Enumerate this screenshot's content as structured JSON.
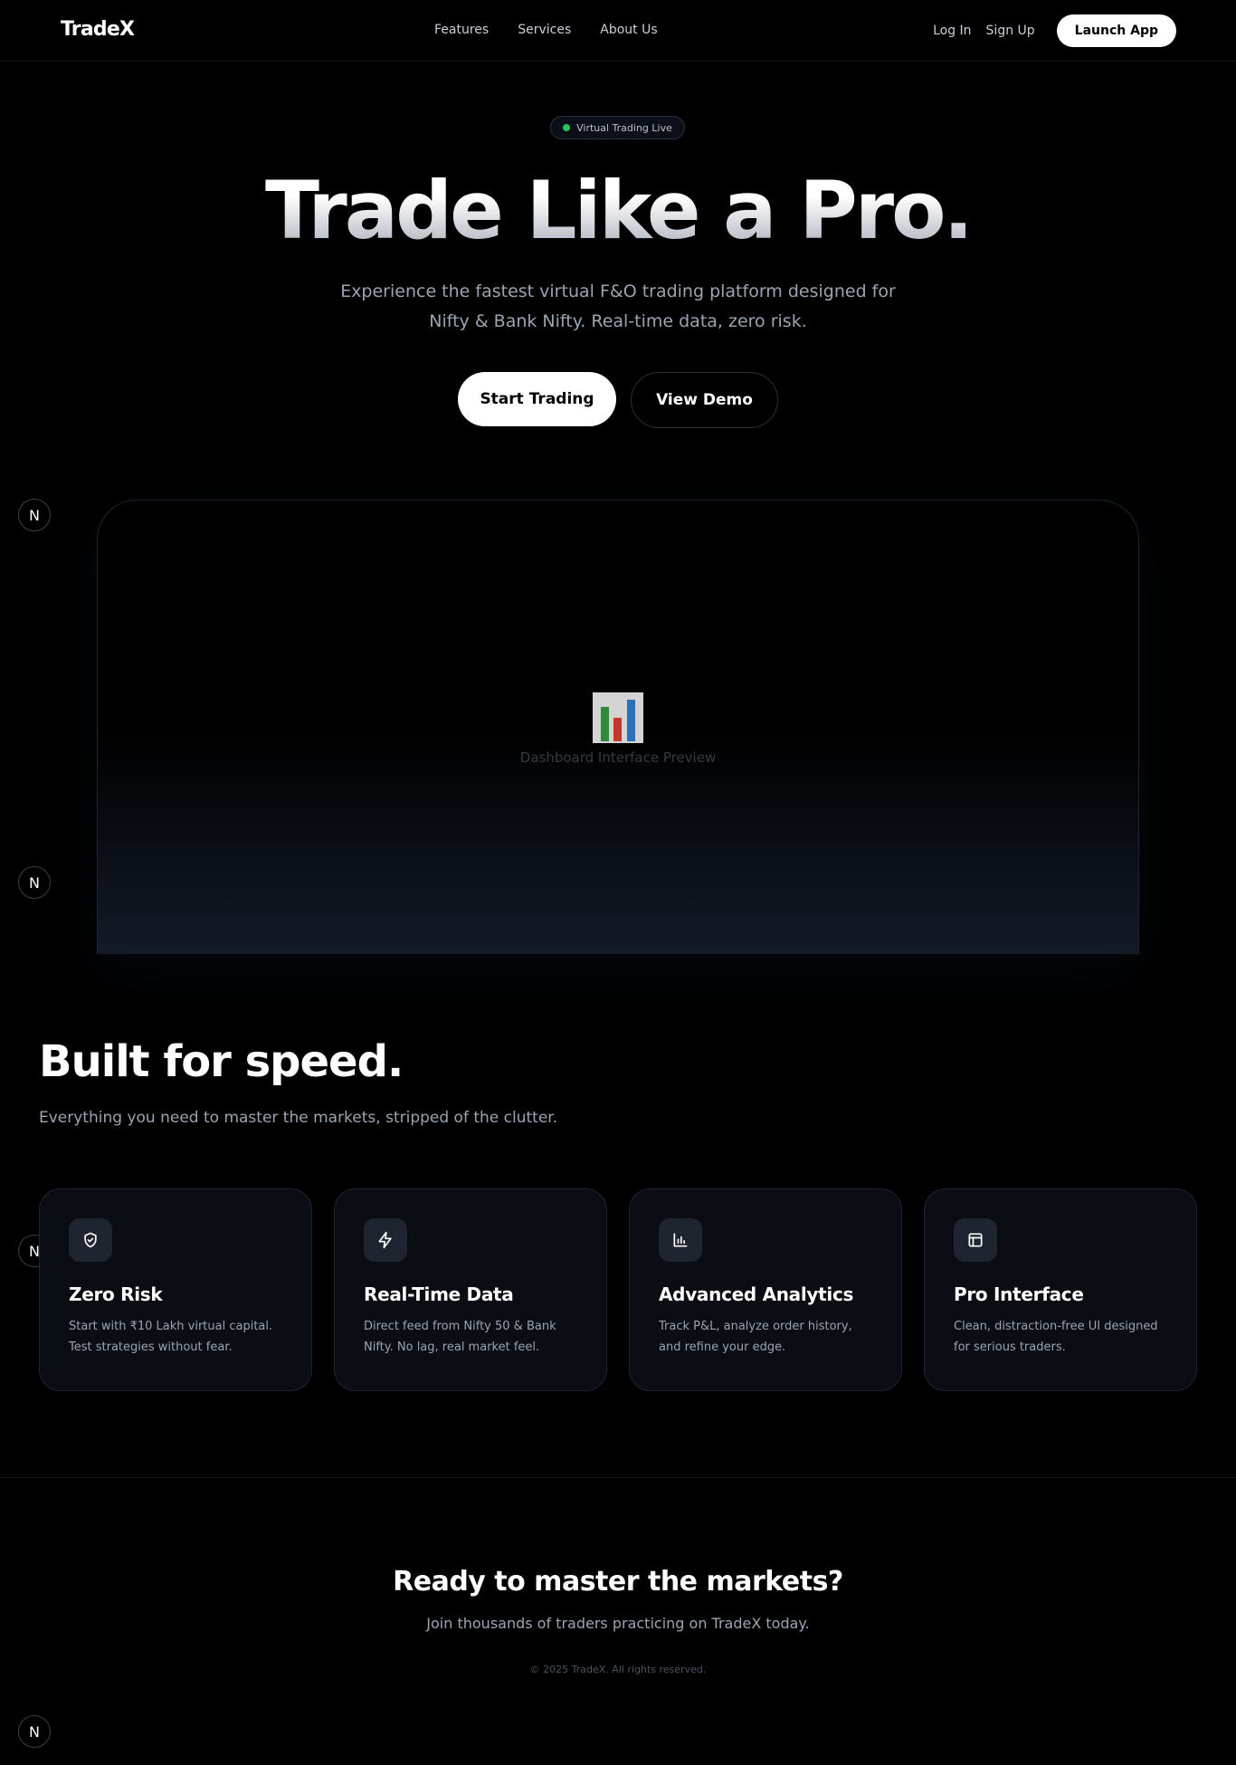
{
  "nav": {
    "brand": "TradeX",
    "links": [
      "Features",
      "Services",
      "About Us"
    ],
    "login": "Log In",
    "signup": "Sign Up",
    "launch": "Launch App"
  },
  "hero": {
    "badge": "Virtual Trading Live",
    "title": "Trade Like a Pro.",
    "subtitle": "Experience the fastest virtual F&O trading platform designed for Nifty & Bank Nifty. Real-time data, zero risk.",
    "primary_cta": "Start Trading",
    "secondary_cta": "View Demo"
  },
  "preview": {
    "label": "Dashboard Interface Preview",
    "icon": "bar-chart-emoji-icon"
  },
  "side_badge": {
    "letter": "N"
  },
  "features": {
    "title": "Built for speed.",
    "subtitle": "Everything you need to master the markets, stripped of the clutter.",
    "cards": [
      {
        "icon": "shield-check-icon",
        "title": "Zero Risk",
        "desc": "Start with ₹10 Lakh virtual capital. Test strategies without fear."
      },
      {
        "icon": "lightning-icon",
        "title": "Real-Time Data",
        "desc": "Direct feed from Nifty 50 & Bank Nifty. No lag, real market feel."
      },
      {
        "icon": "bar-chart-icon",
        "title": "Advanced Analytics",
        "desc": "Track P&L, analyze order history, and refine your edge."
      },
      {
        "icon": "layout-icon",
        "title": "Pro Interface",
        "desc": "Clean, distraction-free UI designed for serious traders."
      }
    ]
  },
  "cta": {
    "title": "Ready to master the markets?",
    "subtitle": "Join thousands of traders practicing on TradeX today.",
    "copyright": "© 2025 TradeX. All rights reserved."
  },
  "colors": {
    "background": "#000000",
    "accent_live": "#22c55e",
    "muted_text": "#9aa4b2",
    "card_bg": "#0a0d13"
  }
}
